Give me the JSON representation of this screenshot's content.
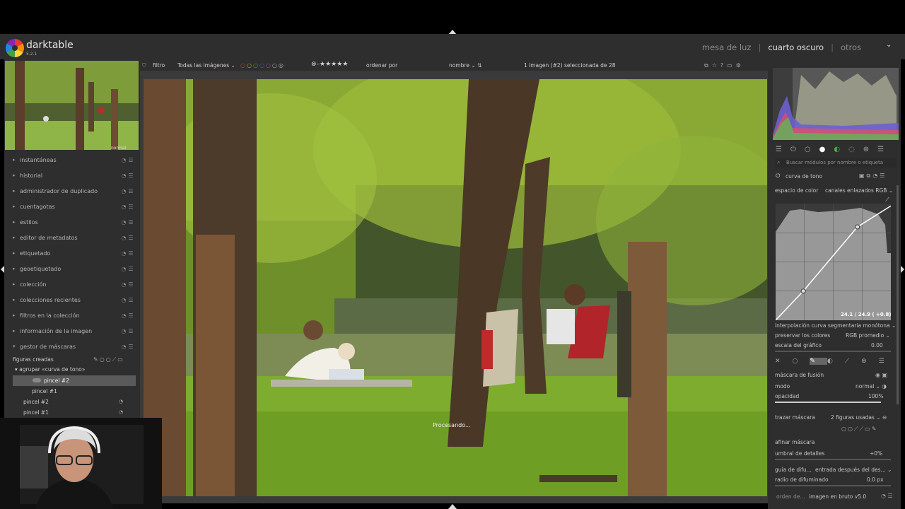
{
  "app": {
    "title": "darktable",
    "version": "5.2.1"
  },
  "views": {
    "lighttable": "mesa de luz",
    "darkroom": "cuarto oscuro",
    "other": "otros"
  },
  "thumbnail": {
    "label": "normal"
  },
  "left_modules": [
    {
      "label": "instantáneas",
      "expanded": false
    },
    {
      "label": "historial",
      "expanded": false
    },
    {
      "label": "administrador de duplicado",
      "expanded": false
    },
    {
      "label": "cuentagotas",
      "expanded": false
    },
    {
      "label": "estilos",
      "expanded": false
    },
    {
      "label": "editor de metadatos",
      "expanded": false
    },
    {
      "label": "etiquetado",
      "expanded": false
    },
    {
      "label": "geoetiquetado",
      "expanded": false
    },
    {
      "label": "colección",
      "expanded": false
    },
    {
      "label": "colecciones recientes",
      "expanded": false
    },
    {
      "label": "filtros en la colección",
      "expanded": false
    },
    {
      "label": "información de la imagen",
      "expanded": false
    },
    {
      "label": "gestor de máscaras",
      "expanded": true
    }
  ],
  "masks": {
    "header": "figuras creadas",
    "group": "agrupar «curva de tono»",
    "group_items": [
      "pincel #2",
      "pincel #1"
    ],
    "items": [
      "pincel #2",
      "pincel #1"
    ]
  },
  "toolbar": {
    "filter": "filtro",
    "all_images": "Todas las imágenes",
    "sort_by": "ordenar por",
    "sort_value": "nombre",
    "selection": "1 imagen (#2) seleccionada de 28"
  },
  "center": {
    "status": "Procesando..."
  },
  "right": {
    "search_placeholder": "Buscar módulos por nombre o etiqueta",
    "module_title": "curva de tono",
    "color_space_label": "espacio de color",
    "color_space_value": "canales enlazados RGB",
    "curve_readout": "24.1 / 24.9 ( +0.8)",
    "interpolation_label": "interpolación curva segmentaria monótona",
    "preserve_label": "preservar los colores",
    "preserve_value": "RGB promedio",
    "scale_label": "escala del gráfico",
    "scale_value": "0.00",
    "blend_mask_label": "máscara de fusión",
    "mode_label": "modo",
    "mode_value": "normal",
    "opacity_label": "opacidad",
    "opacity_value": "100%",
    "opacity_level": 1.0,
    "draw_mask_label": "trazar máscara",
    "draw_mask_value": "2 figuras usadas",
    "refine_label": "afinar máscara",
    "detail_label": "umbral de detalles",
    "detail_value": "+0%",
    "guide_label": "guía de difu...",
    "guide_value": "entrada después del des...",
    "feather_label": "radio de difuminado",
    "feather_value": "0.0 px",
    "order_label": "orden de...",
    "order_value": "imagen en bruto v5.0"
  },
  "curve_points": [
    [
      0.0,
      0.0
    ],
    [
      0.24,
      0.25
    ],
    [
      0.71,
      0.8
    ],
    [
      1.0,
      0.98
    ]
  ]
}
